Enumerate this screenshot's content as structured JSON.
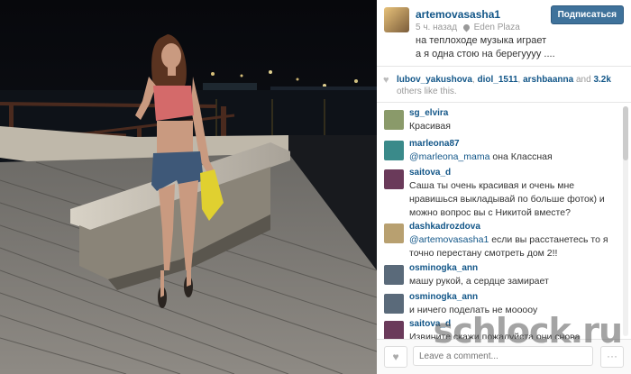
{
  "post": {
    "username": "artemovasasha1",
    "time": "5 ч. назад",
    "location": "Eden Plaza",
    "caption_line1": "на теплоходе музыка играет",
    "caption_line2": "а я одна стою на берегуууу ....",
    "follow_label": "Подписаться"
  },
  "likes": {
    "user1": "lubov_yakushova",
    "user2": "diol_1511",
    "user3": "arshbaanna",
    "and_text": "and",
    "count": "3.2k",
    "others_text": "others like this."
  },
  "comments": [
    {
      "user": "sg_elvira",
      "mention": "",
      "text": "Красивая",
      "avatar_color": "#8a9a6a"
    },
    {
      "user": "marleona87",
      "mention": "@marleona_mama",
      "text": "она Классная",
      "avatar_color": "#3a8a8a"
    },
    {
      "user": "saitova_d",
      "mention": "",
      "text": "Саша ты очень красивая и очень мне нравишься выкладывай по больше фоток) и можно вопрос вы с Никитой вместе?",
      "avatar_color": "#6a3a5a"
    },
    {
      "user": "dashkadrozdova",
      "mention": "@artemovasasha1",
      "text": "если вы расстанетесь то я точно перестану смотреть дом 2!!",
      "avatar_color": "#b8a070"
    },
    {
      "user": "osminogka_ann",
      "mention": "",
      "text": "машу рукой, а сердце замирает",
      "avatar_color": "#5a6a7a"
    },
    {
      "user": "osminogka_ann",
      "mention": "",
      "text": "и ничего поделать не мооооу",
      "avatar_color": "#5a6a7a"
    },
    {
      "user": "saitova_d",
      "mention": "",
      "text": "Извините скажи пожалуйста они снова вместе?",
      "avatar_color": "#6a3a5a"
    }
  ],
  "footer": {
    "comment_placeholder": "Leave a comment..."
  },
  "watermark": "schlock.ru"
}
